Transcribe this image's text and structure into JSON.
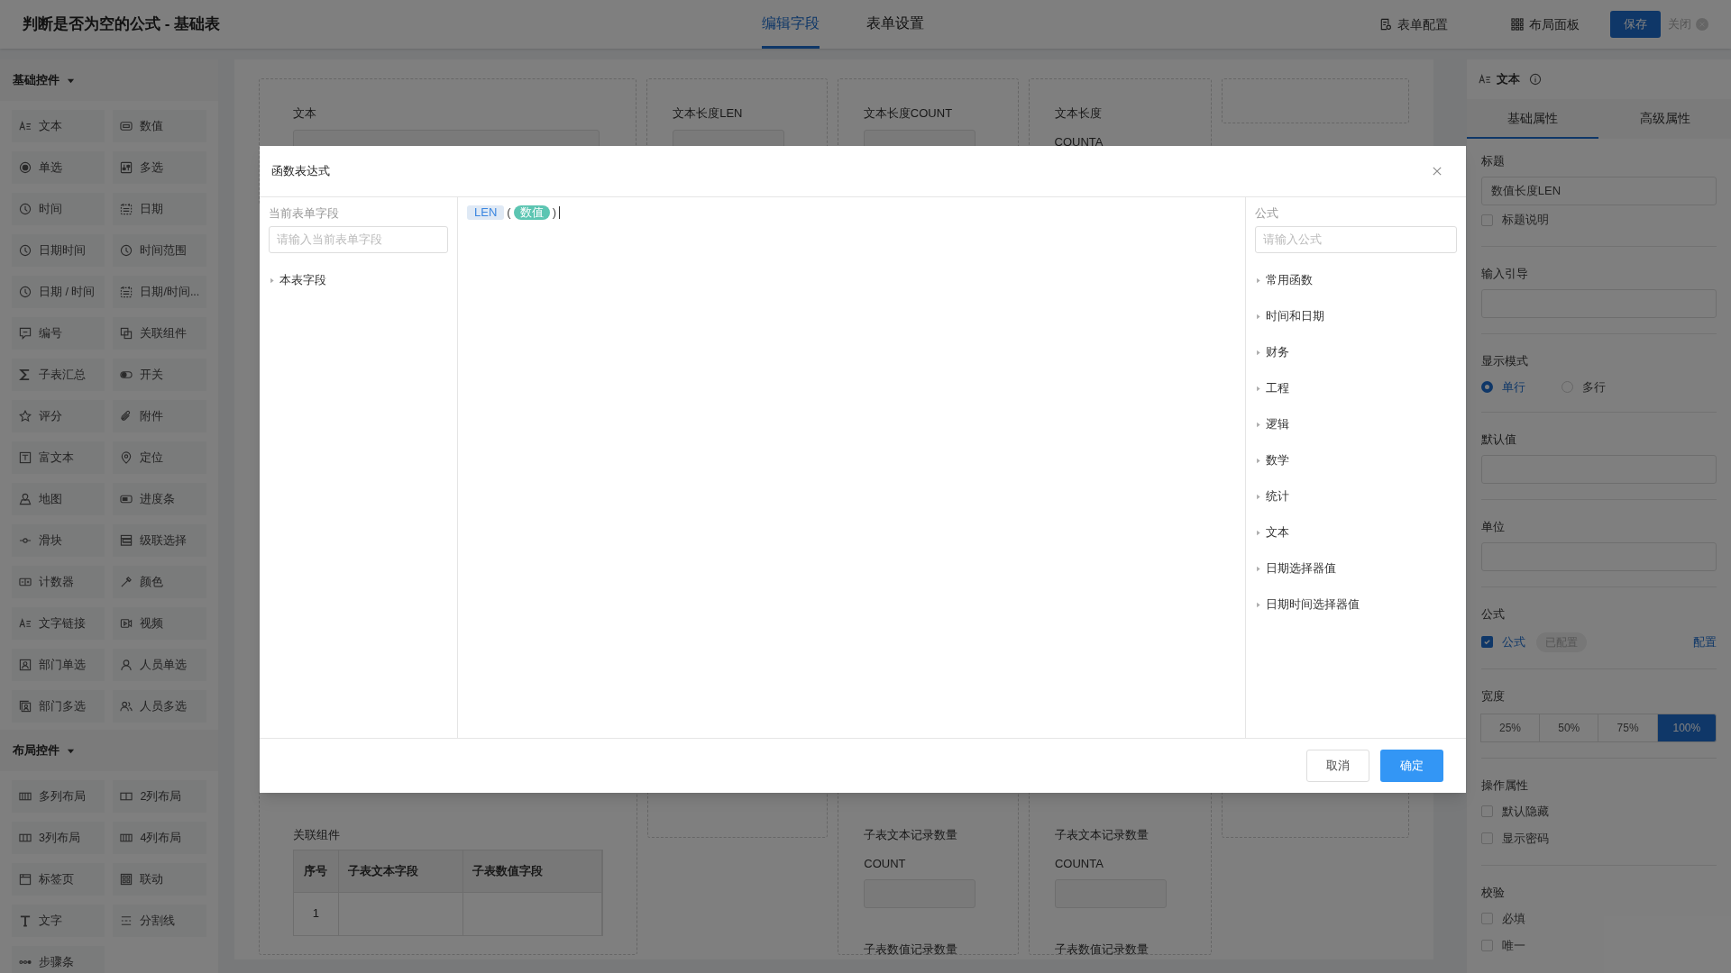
{
  "app": {
    "title": "判断是否为空的公式 - 基础表",
    "tabs": [
      {
        "label": "编辑字段",
        "selected": true
      },
      {
        "label": "表单设置",
        "selected": false
      }
    ],
    "actions": [
      "表单配置",
      "布局面板"
    ],
    "save": "保存",
    "close": "关闭"
  },
  "sidebar": {
    "groups": [
      {
        "title": "基础控件",
        "expanded": true,
        "items": [
          "文本",
          "数值",
          "单选",
          "多选",
          "时间",
          "日期",
          "日期时间",
          "时间范围",
          "日期 / 时间",
          "日期/时间...",
          "编号",
          "关联组件",
          "子表汇总",
          "开关",
          "评分",
          "附件",
          "富文本",
          "定位",
          "地图",
          "进度条",
          "滑块",
          "级联选择",
          "计数器",
          "颜色",
          "文字链接",
          "视频",
          "部门单选",
          "人员单选",
          "部门多选",
          "人员多选"
        ]
      },
      {
        "title": "布局控件",
        "expanded": true,
        "items": [
          "多列布局",
          "2列布局",
          "3列布局",
          "4列布局",
          "标签页",
          "联动",
          "文字",
          "分割线",
          "步骤条"
        ]
      }
    ]
  },
  "canvas": {
    "top_cards": [
      {
        "kind": "input_field",
        "label": "文本"
      },
      {
        "kind": "input_field",
        "label": "文本长度LEN"
      },
      {
        "kind": "input_field",
        "label": "文本长度COUNT"
      },
      {
        "kind": "field",
        "label": "文本长度",
        "sublabel": "COUNTA"
      },
      {
        "kind": "empty"
      }
    ],
    "bottom_cards": [
      {
        "kind": "table",
        "label": "关联组件",
        "columns": [
          "序号",
          "子表文本字段",
          "子表数值字段"
        ],
        "rows": [
          {
            "cells": [
              "1"
            ]
          }
        ]
      },
      {
        "kind": "empty"
      },
      {
        "kind": "stack",
        "fields": [
          {
            "kind": "input_field",
            "label": "子表文本记录数量",
            "sublabel": "COUNT"
          },
          {
            "kind": "field",
            "label": "子表数值记录数量"
          }
        ]
      },
      {
        "kind": "stack",
        "fields": [
          {
            "kind": "input_field",
            "label": "子表文本记录数量",
            "sublabel": "COUNTA"
          },
          {
            "kind": "field",
            "label": "子表数值记录数量"
          }
        ]
      },
      {
        "kind": "empty"
      }
    ]
  },
  "properties": {
    "title": "文本",
    "tabs": [
      {
        "label": "基础属性",
        "selected": true
      },
      {
        "label": "高级属性",
        "selected": false
      }
    ],
    "sections": [
      {
        "kind": "input",
        "label": "标题",
        "value": "数值长度LEN",
        "checkbox": {
          "label": "标题说明",
          "checked": false
        }
      },
      {
        "kind": "input",
        "label": "输入引导"
      },
      {
        "kind": "radio",
        "label": "显示模式",
        "options": [
          {
            "label": "单行",
            "selected": true
          },
          {
            "label": "多行",
            "selected": false
          }
        ]
      },
      {
        "kind": "input",
        "label": "默认值"
      },
      {
        "kind": "input",
        "label": "单位"
      },
      {
        "kind": "formula",
        "label": "公式",
        "checkbox": {
          "label": "公式",
          "checked": true
        },
        "badge": "已配置",
        "link": "配置"
      },
      {
        "kind": "segmented",
        "label": "宽度",
        "options": [
          {
            "label": "25%",
            "selected": false
          },
          {
            "label": "50%",
            "selected": false
          },
          {
            "label": "75%",
            "selected": false
          },
          {
            "label": "100%",
            "selected": true
          }
        ]
      },
      {
        "kind": "checks",
        "label": "操作属性",
        "items": [
          {
            "label": "默认隐藏",
            "checked": false
          },
          {
            "label": "显示密码",
            "checked": false
          }
        ]
      },
      {
        "kind": "checks",
        "label": "校验",
        "items": [
          {
            "label": "必填",
            "checked": false
          },
          {
            "label": "唯一",
            "checked": false
          }
        ]
      }
    ]
  },
  "dialog": {
    "title": "函数表达式",
    "fields_panel": {
      "label": "当前表单字段",
      "placeholder": "请输入当前表单字段",
      "tree": [
        {
          "label": "本表字段",
          "expanded": false
        }
      ]
    },
    "formula": [
      {
        "kind": "function",
        "text": "LEN"
      },
      {
        "kind": "paren",
        "text": "("
      },
      {
        "kind": "field",
        "text": "数值"
      },
      {
        "kind": "paren",
        "text": ")"
      }
    ],
    "functions_panel": {
      "label": "公式",
      "placeholder": "请输入公式",
      "categories": [
        {
          "label": "常用函数",
          "expanded": false
        },
        {
          "label": "时间和日期",
          "expanded": false
        },
        {
          "label": "财务",
          "expanded": false
        },
        {
          "label": "工程",
          "expanded": false
        },
        {
          "label": "逻辑",
          "expanded": false
        },
        {
          "label": "数学",
          "expanded": false
        },
        {
          "label": "统计",
          "expanded": false
        },
        {
          "label": "文本",
          "expanded": false
        },
        {
          "label": "日期选择器值",
          "expanded": false
        },
        {
          "label": "日期时间选择器值",
          "expanded": false
        }
      ]
    },
    "buttons": [
      {
        "kind": "secondary",
        "label": "取消"
      },
      {
        "kind": "primary",
        "label": "确定"
      }
    ]
  }
}
